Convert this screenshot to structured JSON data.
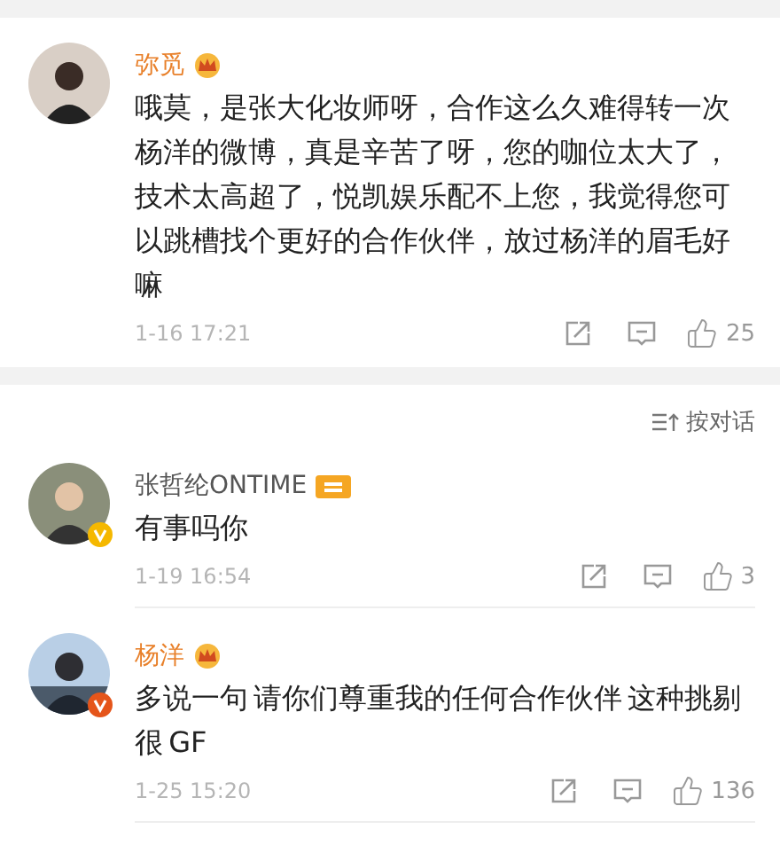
{
  "sort": {
    "label": "按对话"
  },
  "comments": [
    {
      "name": "弥觅",
      "member": true,
      "badge": {
        "kind": "crown"
      },
      "text": "哦莫，是张大化妆师呀，合作这么久难得转一次杨洋的微博，真是辛苦了呀，您的咖位太大了，技术太高超了，悦凯娱乐配不上您，我觉得您可以跳槽找个更好的合作伙伴，放过杨洋的眉毛好嘛",
      "time": "1-16 17:21",
      "likes": "25"
    },
    {
      "name": "张哲纶ONTIME",
      "member": false,
      "badge": {
        "kind": "tag"
      },
      "verified": {
        "color": "#f5b800"
      },
      "text": "有事吗你",
      "time": "1-19 16:54",
      "likes": "3"
    },
    {
      "name": "杨洋",
      "member": true,
      "badge": {
        "kind": "crown"
      },
      "verified": {
        "color": "#e5551a"
      },
      "text": "多说一句 请你们尊重我的任何合作伙伴 这种挑剔很 GF",
      "time": "1-25 15:20",
      "likes": "136"
    }
  ]
}
